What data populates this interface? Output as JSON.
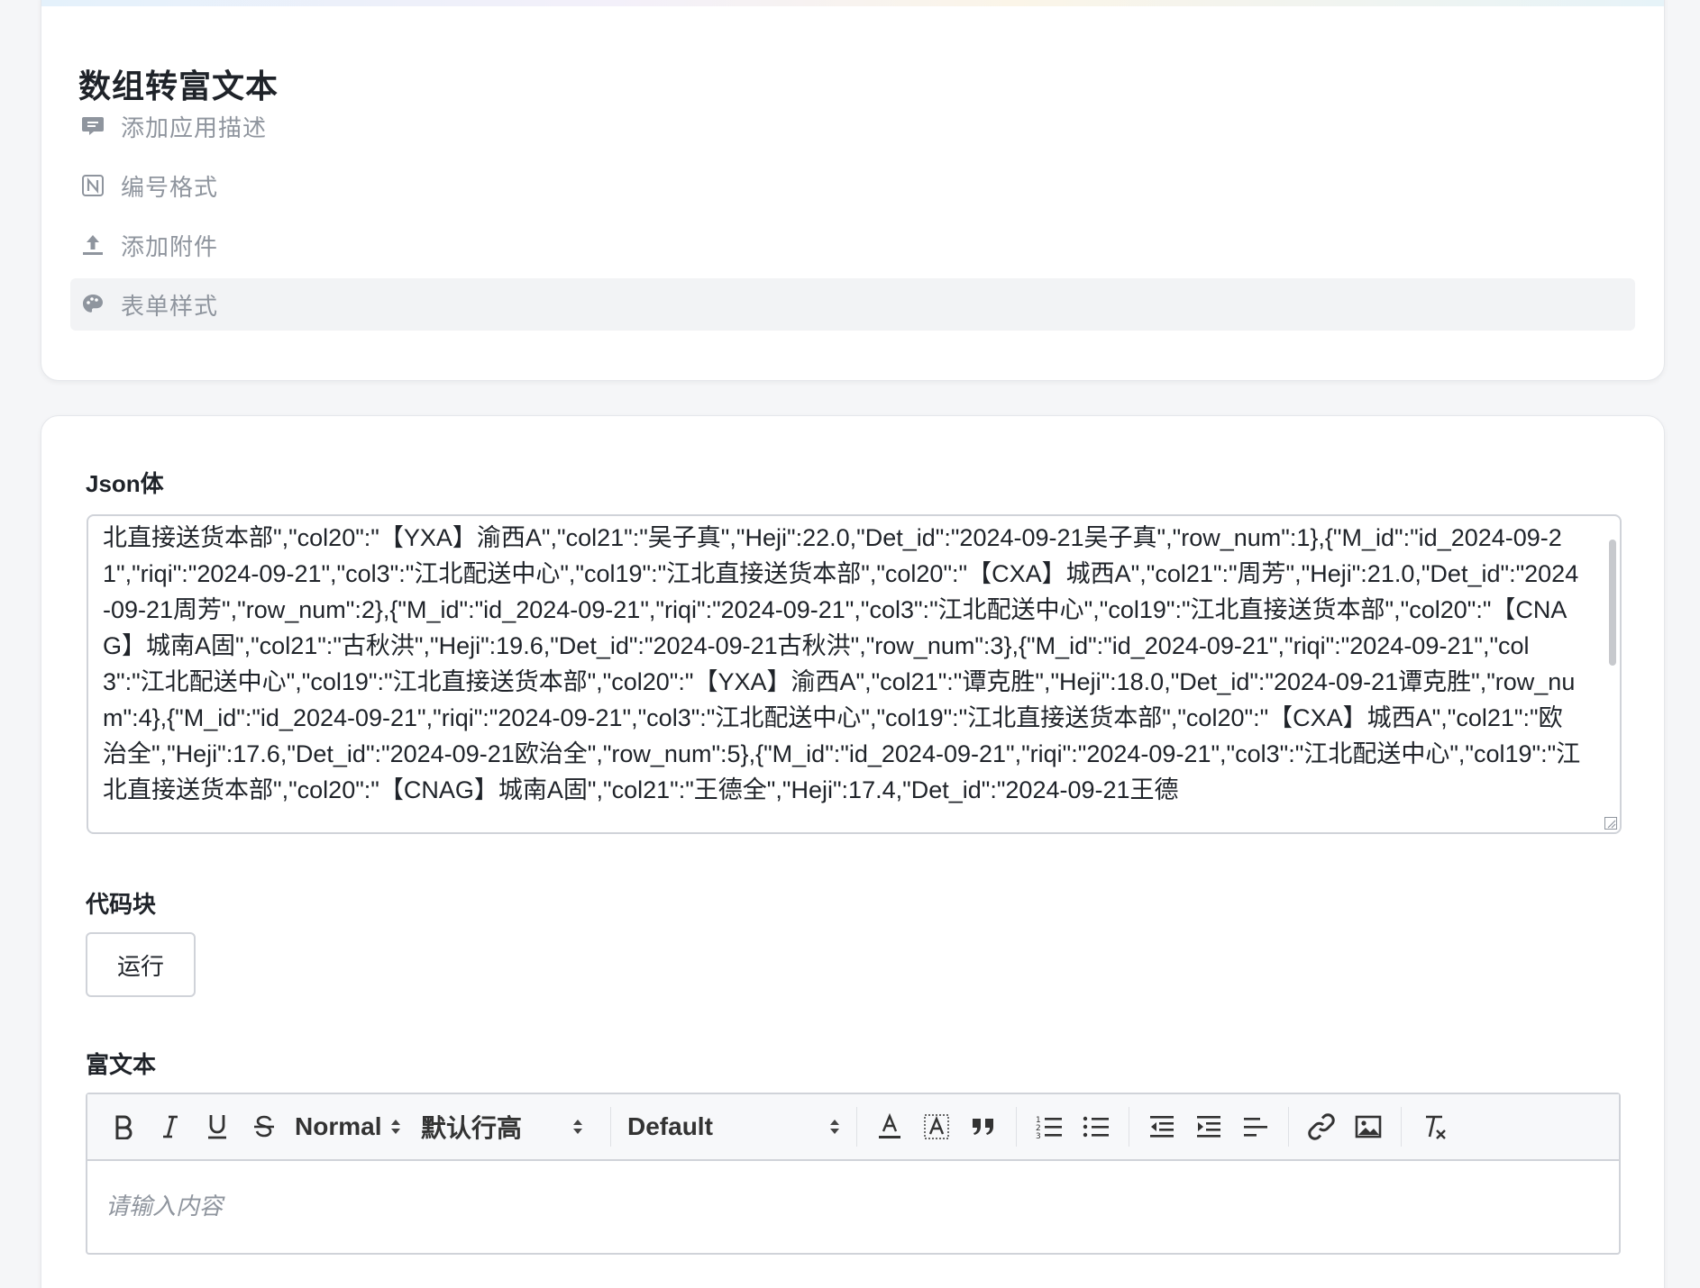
{
  "app": {
    "title": "数组转富文本",
    "menu": [
      {
        "label": "添加应用描述",
        "icon": "comment-icon"
      },
      {
        "label": "编号格式",
        "icon": "number-format-icon"
      },
      {
        "label": "添加附件",
        "icon": "upload-icon"
      },
      {
        "label": "表单样式",
        "icon": "palette-icon"
      }
    ]
  },
  "form": {
    "json_label": "Json体",
    "json_value": "北直接送货本部\",\"col20\":\"【YXA】渝西A\",\"col21\":\"吴子真\",\"Heji\":22.0,\"Det_id\":\"2024-09-21吴子真\",\"row_num\":1},{\"M_id\":\"id_2024-09-21\",\"riqi\":\"2024-09-21\",\"col3\":\"江北配送中心\",\"col19\":\"江北直接送货本部\",\"col20\":\"【CXA】城西A\",\"col21\":\"周芳\",\"Heji\":21.0,\"Det_id\":\"2024-09-21周芳\",\"row_num\":2},{\"M_id\":\"id_2024-09-21\",\"riqi\":\"2024-09-21\",\"col3\":\"江北配送中心\",\"col19\":\"江北直接送货本部\",\"col20\":\"【CNAG】城南A固\",\"col21\":\"古秋洪\",\"Heji\":19.6,\"Det_id\":\"2024-09-21古秋洪\",\"row_num\":3},{\"M_id\":\"id_2024-09-21\",\"riqi\":\"2024-09-21\",\"col3\":\"江北配送中心\",\"col19\":\"江北直接送货本部\",\"col20\":\"【YXA】渝西A\",\"col21\":\"谭克胜\",\"Heji\":18.0,\"Det_id\":\"2024-09-21谭克胜\",\"row_num\":4},{\"M_id\":\"id_2024-09-21\",\"riqi\":\"2024-09-21\",\"col3\":\"江北配送中心\",\"col19\":\"江北直接送货本部\",\"col20\":\"【CXA】城西A\",\"col21\":\"欧治全\",\"Heji\":17.6,\"Det_id\":\"2024-09-21欧治全\",\"row_num\":5},{\"M_id\":\"id_2024-09-21\",\"riqi\":\"2024-09-21\",\"col3\":\"江北配送中心\",\"col19\":\"江北直接送货本部\",\"col20\":\"【CNAG】城南A固\",\"col21\":\"王德全\",\"Heji\":17.4,\"Det_id\":\"2024-09-21王德",
    "code_label": "代码块",
    "run_label": "运行",
    "richtext_label": "富文本",
    "toolbar": {
      "header_select": "Normal",
      "line_height_select": "默认行高",
      "font_select": "Default",
      "buttons": [
        "bold-icon",
        "italic-icon",
        "underline-icon",
        "strike-icon",
        "font-color-icon",
        "background-color-icon",
        "blockquote-icon",
        "ordered-list-icon",
        "bullet-list-icon",
        "outdent-icon",
        "indent-icon",
        "align-icon",
        "link-icon",
        "image-icon",
        "clear-format-icon"
      ]
    },
    "editor_placeholder": "请输入内容"
  },
  "colors": {
    "text": "#1f2329",
    "muted": "#8f959e",
    "border": "#d0d3d9",
    "active_bg": "#f2f3f5"
  }
}
